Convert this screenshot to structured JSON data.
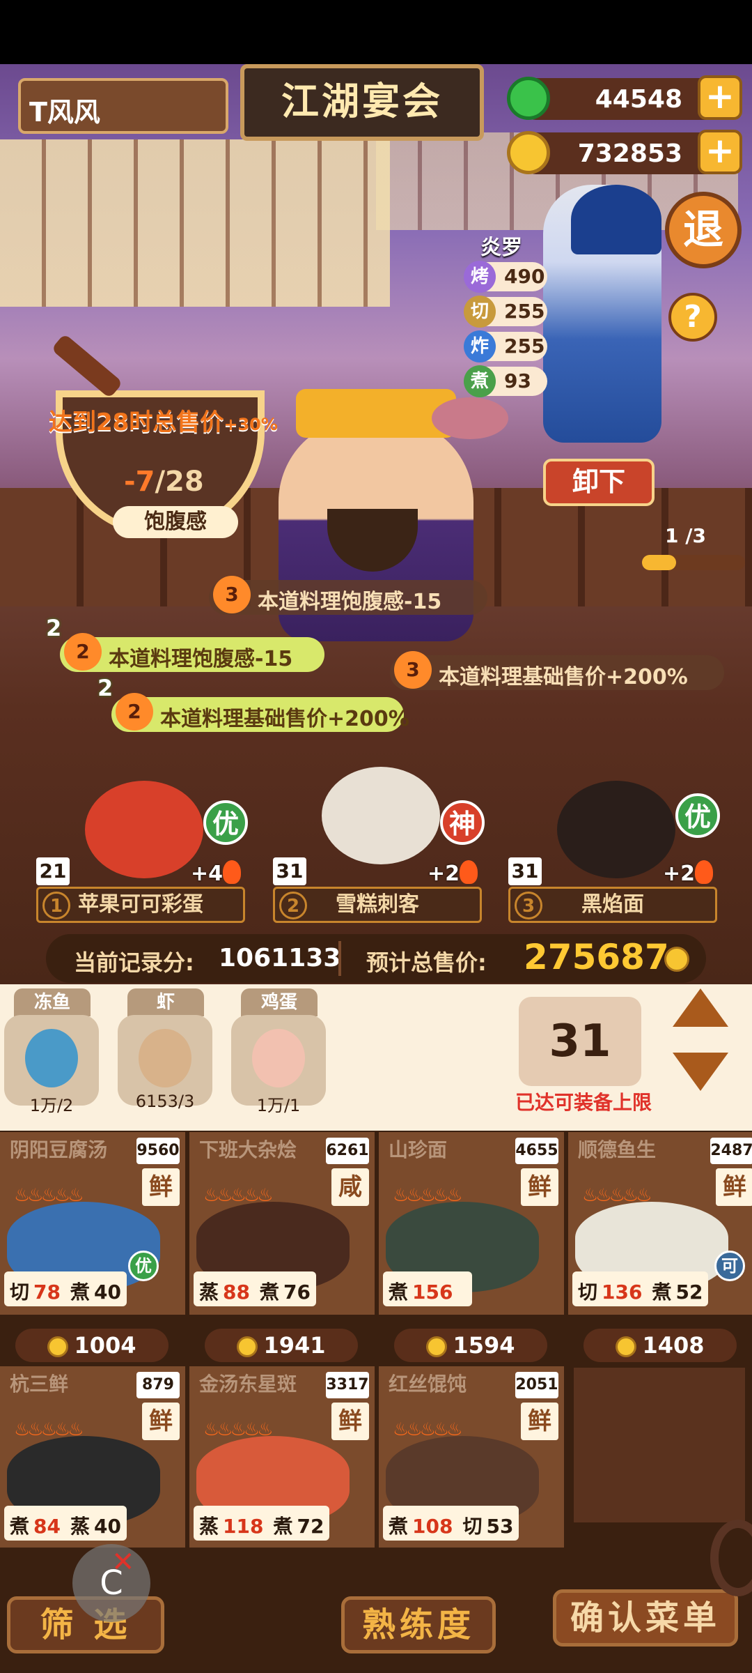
{
  "header": {
    "player_name": "T风风",
    "title_sign": "江湖宴会",
    "jade_amount": "44548",
    "coin_amount": "732853",
    "plus": "+",
    "exit_label": "退",
    "help_label": "?"
  },
  "chef": {
    "name": "炎罗",
    "stats": [
      {
        "label": "烤",
        "value": "490",
        "color": "#9a6ad8"
      },
      {
        "label": "切",
        "value": "255",
        "color": "#c89a3c"
      },
      {
        "label": "炸",
        "value": "255",
        "color": "#3a7ad8"
      },
      {
        "label": "煮",
        "value": "93",
        "color": "#4aa04a"
      }
    ],
    "unload_label": "卸下"
  },
  "satiety": {
    "bonus_text": "达到28时总售价",
    "bonus_pct": "+30%",
    "value_neg": "-7",
    "value_max": "/28",
    "label": "饱腹感"
  },
  "guest_progress": {
    "text": "1 /3",
    "fraction": 0.33
  },
  "buffs": [
    {
      "level": "3",
      "text": "本道料理饱腹感-15",
      "style": "dark",
      "count": ""
    },
    {
      "level": "2",
      "text": "本道料理饱腹感-15",
      "style": "green",
      "count": "2"
    },
    {
      "level": "3",
      "text": "本道料理基础售价+200%",
      "style": "dark",
      "count": ""
    },
    {
      "level": "2",
      "text": "本道料理基础售价+200%",
      "style": "green",
      "count": "2"
    }
  ],
  "served_dishes": [
    {
      "slot": "1",
      "name": "苹果可可彩蛋",
      "count": "21",
      "fire": "+4",
      "badge": "优",
      "badge_color": "#3aa048"
    },
    {
      "slot": "2",
      "name": "雪糕刺客",
      "count": "31",
      "fire": "+2",
      "badge": "神",
      "badge_color": "#d8402a"
    },
    {
      "slot": "3",
      "name": "黑焰面",
      "count": "31",
      "fire": "+2",
      "badge": "优",
      "badge_color": "#3aa048"
    }
  ],
  "score": {
    "record_label": "当前记录分:",
    "record_value": "1061133",
    "price_label": "预计总售价:",
    "price_value": "275687"
  },
  "ingredients": [
    {
      "name": "冻鱼",
      "qty": "1万/2"
    },
    {
      "name": "虾",
      "qty": "6153/3"
    },
    {
      "name": "鸡蛋",
      "qty": "1万/1"
    }
  ],
  "equip": {
    "count": "31",
    "label": "已达可装备上限"
  },
  "recipes": [
    {
      "name": "阴阳豆腐汤",
      "price_tag": "9560",
      "taste": "鲜",
      "s1": "切",
      "v1": "78",
      "s2": "煮",
      "v2": "40",
      "coin": "1004",
      "grade": "优"
    },
    {
      "name": "下班大杂烩",
      "price_tag": "6261",
      "taste": "咸",
      "s1": "蒸",
      "v1": "88",
      "s2": "煮",
      "v2": "76",
      "coin": "1941",
      "grade": ""
    },
    {
      "name": "山珍面",
      "price_tag": "4655",
      "taste": "鲜",
      "s1": "煮",
      "v1": "156",
      "s2": "",
      "v2": "",
      "coin": "1594",
      "grade": ""
    },
    {
      "name": "顺德鱼生",
      "price_tag": "2487",
      "taste": "鲜",
      "s1": "切",
      "v1": "136",
      "s2": "煮",
      "v2": "52",
      "coin": "1408",
      "grade": "可"
    },
    {
      "name": "杭三鲜",
      "price_tag": "879",
      "taste": "鲜",
      "s1": "煮",
      "v1": "84",
      "s2": "蒸",
      "v2": "40",
      "coin": "",
      "grade": ""
    },
    {
      "name": "金汤东星斑",
      "price_tag": "3317",
      "taste": "鲜",
      "s1": "蒸",
      "v1": "118",
      "s2": "煮",
      "v2": "72",
      "coin": "",
      "grade": ""
    },
    {
      "name": "红丝馄饨",
      "price_tag": "2051",
      "taste": "鲜",
      "s1": "煮",
      "v1": "108",
      "s2": "切",
      "v2": "53",
      "coin": "",
      "grade": ""
    }
  ],
  "bottom": {
    "filter_label": "筛 选",
    "skill_label": "熟练度",
    "confirm_label": "确认菜单"
  },
  "stars": "♨♨♨♨♨"
}
